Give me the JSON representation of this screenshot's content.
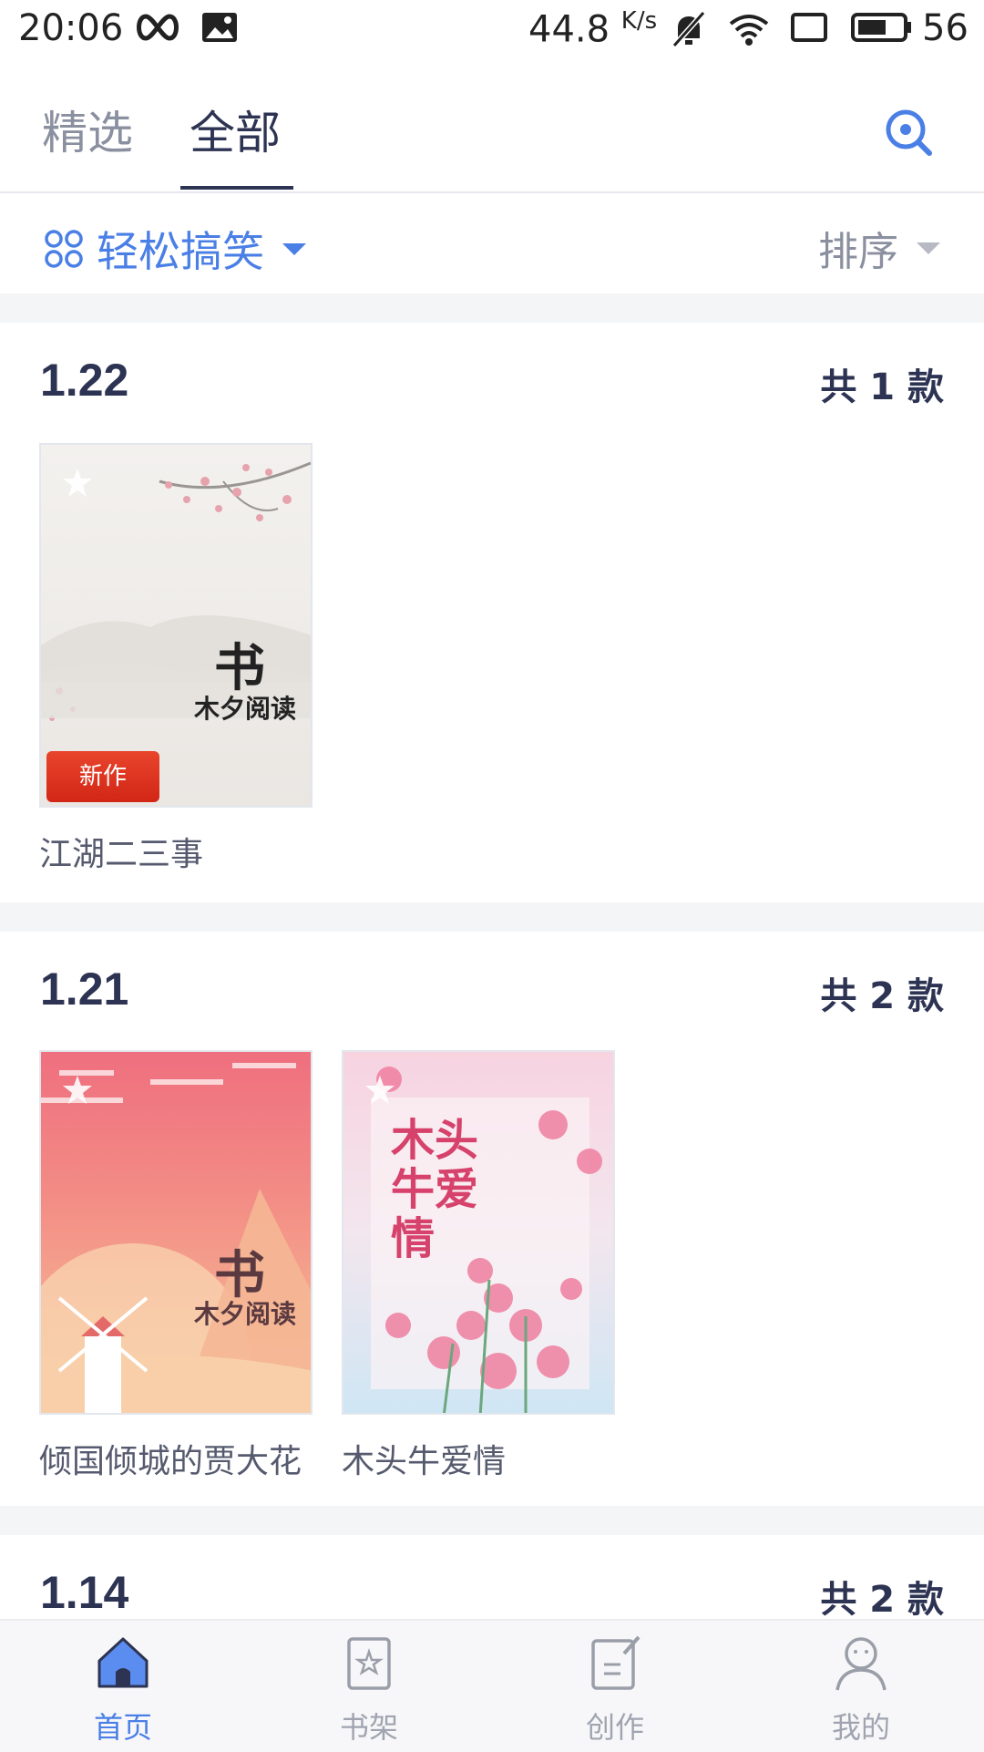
{
  "status_bar": {
    "time": "20:06",
    "speed": "44.8",
    "speed_unit": "K/s",
    "battery": "56",
    "icons": [
      "infinity-icon",
      "image-icon",
      "mute-bell-icon",
      "wifi-icon",
      "screen-rotate-icon",
      "battery-icon"
    ]
  },
  "tabs": [
    {
      "label": "精选",
      "active": false
    },
    {
      "label": "全部",
      "active": true
    }
  ],
  "filter": {
    "category": "轻松搞笑",
    "sort": "排序"
  },
  "colors": {
    "accent": "#4a7fe6",
    "text_dark": "#2d3352",
    "badge_red": "#d22616"
  },
  "sections": [
    {
      "date": "1.22",
      "count": "共 1 款",
      "books": [
        {
          "title": "江湖二三事",
          "badge": "新作",
          "cover_text": "木夕阅读"
        }
      ]
    },
    {
      "date": "1.21",
      "count": "共 2 款",
      "books": [
        {
          "title": "倾国倾城的贾大花",
          "cover_text": "木夕阅读"
        },
        {
          "title": "木头牛爱情",
          "cover_title": "木头牛爱情"
        }
      ]
    },
    {
      "date": "1.14",
      "count": "共 2 款"
    }
  ],
  "bottom_nav": [
    {
      "label": "首页",
      "icon": "home-icon",
      "active": true
    },
    {
      "label": "书架",
      "icon": "bookshelf-icon",
      "active": false
    },
    {
      "label": "创作",
      "icon": "write-icon",
      "active": false
    },
    {
      "label": "我的",
      "icon": "profile-icon",
      "active": false
    }
  ]
}
